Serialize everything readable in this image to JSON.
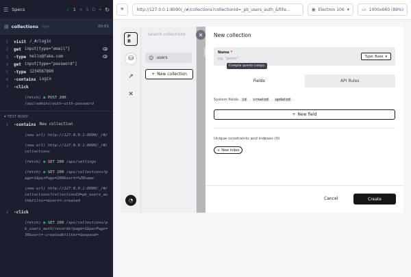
{
  "runner": {
    "title": "Specs",
    "passed": "1",
    "failed": "5",
    "pending": "O",
    "spec_name": "collections",
    "spec_file": ".cy.js",
    "duration": "00:01",
    "section_before": "",
    "section_test": "TEST BODY"
  },
  "commands_before": [
    {
      "num": "1",
      "cmd": "visit",
      "arg": "/_#/login"
    },
    {
      "num": "2",
      "cmd": "get",
      "arg": "input[type=\"email\"]"
    },
    {
      "num": "3",
      "cmd": "-type",
      "arg": "hello@fake.com"
    },
    {
      "num": "4",
      "cmd": "get",
      "arg": "input[type=\"password\"]"
    },
    {
      "num": "5",
      "cmd": "-type",
      "arg": "1234567890"
    },
    {
      "num": "6",
      "cmd": "-contains",
      "arg": "Login"
    },
    {
      "num": "7",
      "cmd": "-click",
      "arg": ""
    }
  ],
  "fetch_login": {
    "label": "(fetch)",
    "status": "POST 200",
    "url": "/api/admins/auth-with-password"
  },
  "commands_test": {
    "contains": {
      "num": "1",
      "cmd": "-contains",
      "arg": "New collection"
    },
    "newurl_1": {
      "label": "(new url)",
      "url": "http://127.0.0.1:8090/_/#/"
    },
    "newurl_2": {
      "label": "(new url)",
      "url": "http://127.0.0.1:8090/_/#/collections"
    },
    "fetch_settings": {
      "label": "(fetch)",
      "status": "GET 200",
      "url": "/api/settings"
    },
    "fetch_collections": {
      "label": "(fetch)",
      "status": "GET 200",
      "url": "/api/collections?page=1&perPage=200&sort=%2Bname"
    },
    "newurl_3": {
      "label": "(new url)",
      "url": "http://127.0.0.1:8090/_/#/collections?collectionId=pb_users_auth&filter=&sort=-created"
    },
    "click": {
      "num": "2",
      "cmd": "-click",
      "arg": ""
    },
    "fetch_records": {
      "label": "(fetch)",
      "status": "GET 200",
      "url": "/api/collections/pb_users_auth/records?page=1&perPage=30&sort=-created&filter=&expand="
    }
  },
  "browser": {
    "url": "http://127.0.0.1:8090/_/#/collections?collectionId=_pb_users_auth_&filte...",
    "browser_name": "Electron 106",
    "viewport": "1000x660 (89%)"
  },
  "app": {
    "logo": "PB",
    "search_placeholder": "Search collections",
    "collection_item": "users",
    "new_collection_button": "New collection"
  },
  "modal": {
    "title": "New collection",
    "name_label": "Name",
    "name_required": "*",
    "name_placeholder": "eg. \"posts\"",
    "tooltip": "Compila questo campo.",
    "type_button": "Type: Base",
    "tab_fields": "Fields",
    "tab_api_rules": "API Rules",
    "system_fields_label": "System fields:",
    "system_fields": [
      "id",
      "created",
      "updated"
    ],
    "new_field": "New field",
    "indexes_label": "Unique constraints and indexes (0)",
    "new_index": "New index",
    "cancel": "Cancel",
    "create": "Create"
  },
  "colors": {
    "accent_ok": "#1fa971",
    "runner_bg": "#1b1e2e",
    "primary_btn": "#16161a"
  }
}
